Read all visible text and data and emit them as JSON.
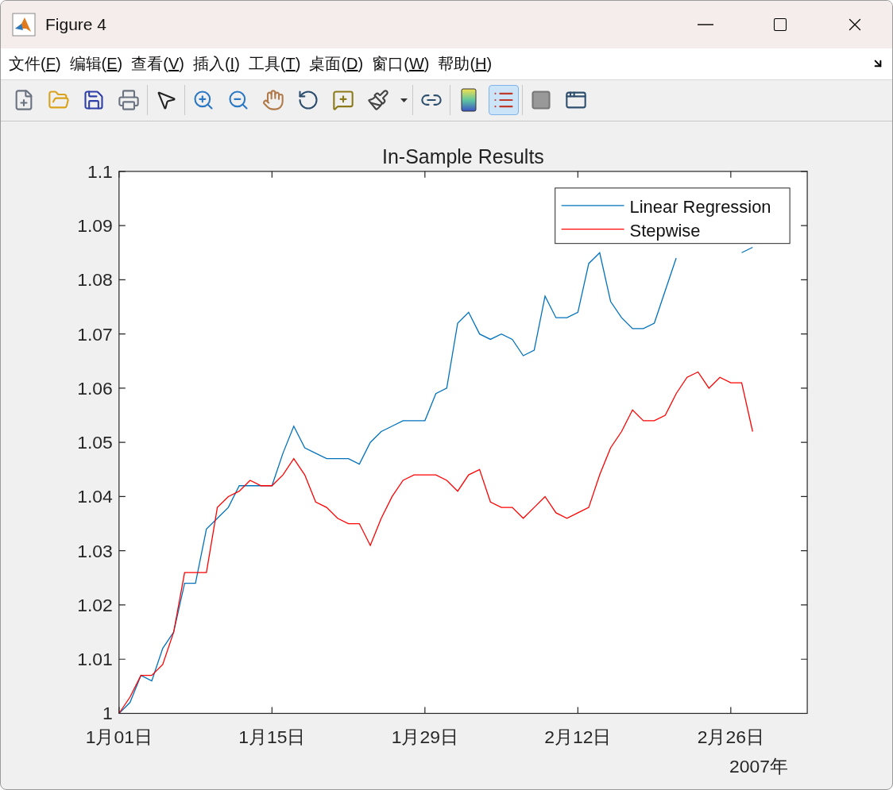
{
  "window": {
    "title": "Figure 4"
  },
  "menu": [
    "文件(F)",
    "编辑(E)",
    "查看(V)",
    "插入(I)",
    "工具(T)",
    "桌面(D)",
    "窗口(W)",
    "帮助(H)"
  ],
  "toolbar": {
    "groups": [
      [
        {
          "kind": "button",
          "selected": false
        },
        {
          "kind": "button",
          "selected": false
        },
        {
          "kind": "button",
          "selected": false
        },
        {
          "kind": "button",
          "selected": false
        }
      ],
      [
        {
          "kind": "button",
          "selected": false
        }
      ],
      [
        {
          "kind": "button",
          "selected": false
        },
        {
          "kind": "button",
          "selected": false
        },
        {
          "kind": "button",
          "selected": false
        },
        {
          "kind": "button",
          "selected": false
        },
        {
          "kind": "button",
          "selected": false
        },
        {
          "kind": "button",
          "selected": false
        },
        {
          "kind": "dropdown",
          "selected": false
        }
      ],
      [
        {
          "kind": "button",
          "selected": false
        }
      ],
      [
        {
          "kind": "button",
          "selected": false
        },
        {
          "kind": "button",
          "selected": true
        }
      ],
      [
        {
          "kind": "button",
          "selected": false
        },
        {
          "kind": "button",
          "selected": false
        }
      ]
    ]
  },
  "figure": {
    "chart_data": {
      "type": "line",
      "title": "In-Sample Results",
      "xlabel": "2007年",
      "categories": [
        "1月01日",
        null,
        null,
        null,
        null,
        null,
        null,
        null,
        null,
        null,
        null,
        null,
        null,
        null,
        "1月15日",
        null,
        null,
        null,
        null,
        null,
        null,
        null,
        null,
        null,
        null,
        null,
        null,
        null,
        "1月29日",
        null,
        null,
        null,
        null,
        null,
        null,
        null,
        null,
        null,
        null,
        null,
        null,
        null,
        "2月12日",
        null,
        null,
        null,
        null,
        null,
        null,
        null,
        null,
        null,
        null,
        null,
        null,
        null,
        "2月26日",
        null,
        null,
        null,
        null,
        null,
        null,
        null
      ],
      "series": [
        {
          "name": "Linear Regression",
          "color": "#0072bd",
          "values": [
            1.0,
            1.002,
            1.007,
            1.006,
            1.012,
            1.015,
            1.024,
            1.024,
            1.034,
            1.036,
            1.038,
            1.042,
            1.042,
            1.042,
            1.042,
            1.048,
            1.053,
            1.049,
            1.048,
            1.047,
            1.047,
            1.047,
            1.046,
            1.05,
            1.052,
            1.053,
            1.054,
            1.054,
            1.054,
            1.059,
            1.06,
            1.072,
            1.074,
            1.07,
            1.069,
            1.07,
            1.069,
            1.066,
            1.067,
            1.077,
            1.073,
            1.073,
            1.074,
            1.083,
            1.085,
            1.076,
            1.073,
            1.071,
            1.071,
            1.072,
            1.078,
            1.084,
            null,
            null,
            null,
            null,
            null,
            1.085,
            1.086,
            null,
            null,
            null,
            null,
            null
          ]
        },
        {
          "name": "Stepwise",
          "color": "#ff0000",
          "values": [
            1.0,
            1.003,
            1.007,
            1.007,
            1.009,
            1.015,
            1.026,
            1.026,
            1.026,
            1.038,
            1.04,
            1.041,
            1.043,
            1.042,
            1.042,
            1.044,
            1.047,
            1.044,
            1.039,
            1.038,
            1.036,
            1.035,
            1.035,
            1.031,
            1.036,
            1.04,
            1.043,
            1.044,
            1.044,
            1.044,
            1.043,
            1.041,
            1.044,
            1.045,
            1.039,
            1.038,
            1.038,
            1.036,
            1.038,
            1.04,
            1.037,
            1.036,
            1.037,
            1.038,
            1.044,
            1.049,
            1.052,
            1.056,
            1.054,
            1.054,
            1.055,
            1.059,
            1.062,
            1.063,
            1.06,
            1.062,
            1.061,
            1.061,
            1.052,
            null,
            null,
            null,
            null,
            null
          ]
        }
      ],
      "legend": true,
      "ylim": [
        1,
        1.1
      ],
      "yticks": [
        {
          "value": 1,
          "label": "1"
        },
        {
          "value": 1.01,
          "label": "1.01"
        },
        {
          "value": 1.02,
          "label": "1.02"
        },
        {
          "value": 1.03,
          "label": "1.03"
        },
        {
          "value": 1.04,
          "label": "1.04"
        },
        {
          "value": 1.05,
          "label": "1.05"
        },
        {
          "value": 1.06,
          "label": "1.06"
        },
        {
          "value": 1.07,
          "label": "1.07"
        },
        {
          "value": 1.08,
          "label": "1.08"
        },
        {
          "value": 1.09,
          "label": "1.09"
        },
        {
          "value": 1.1,
          "label": "1.1"
        }
      ]
    }
  }
}
